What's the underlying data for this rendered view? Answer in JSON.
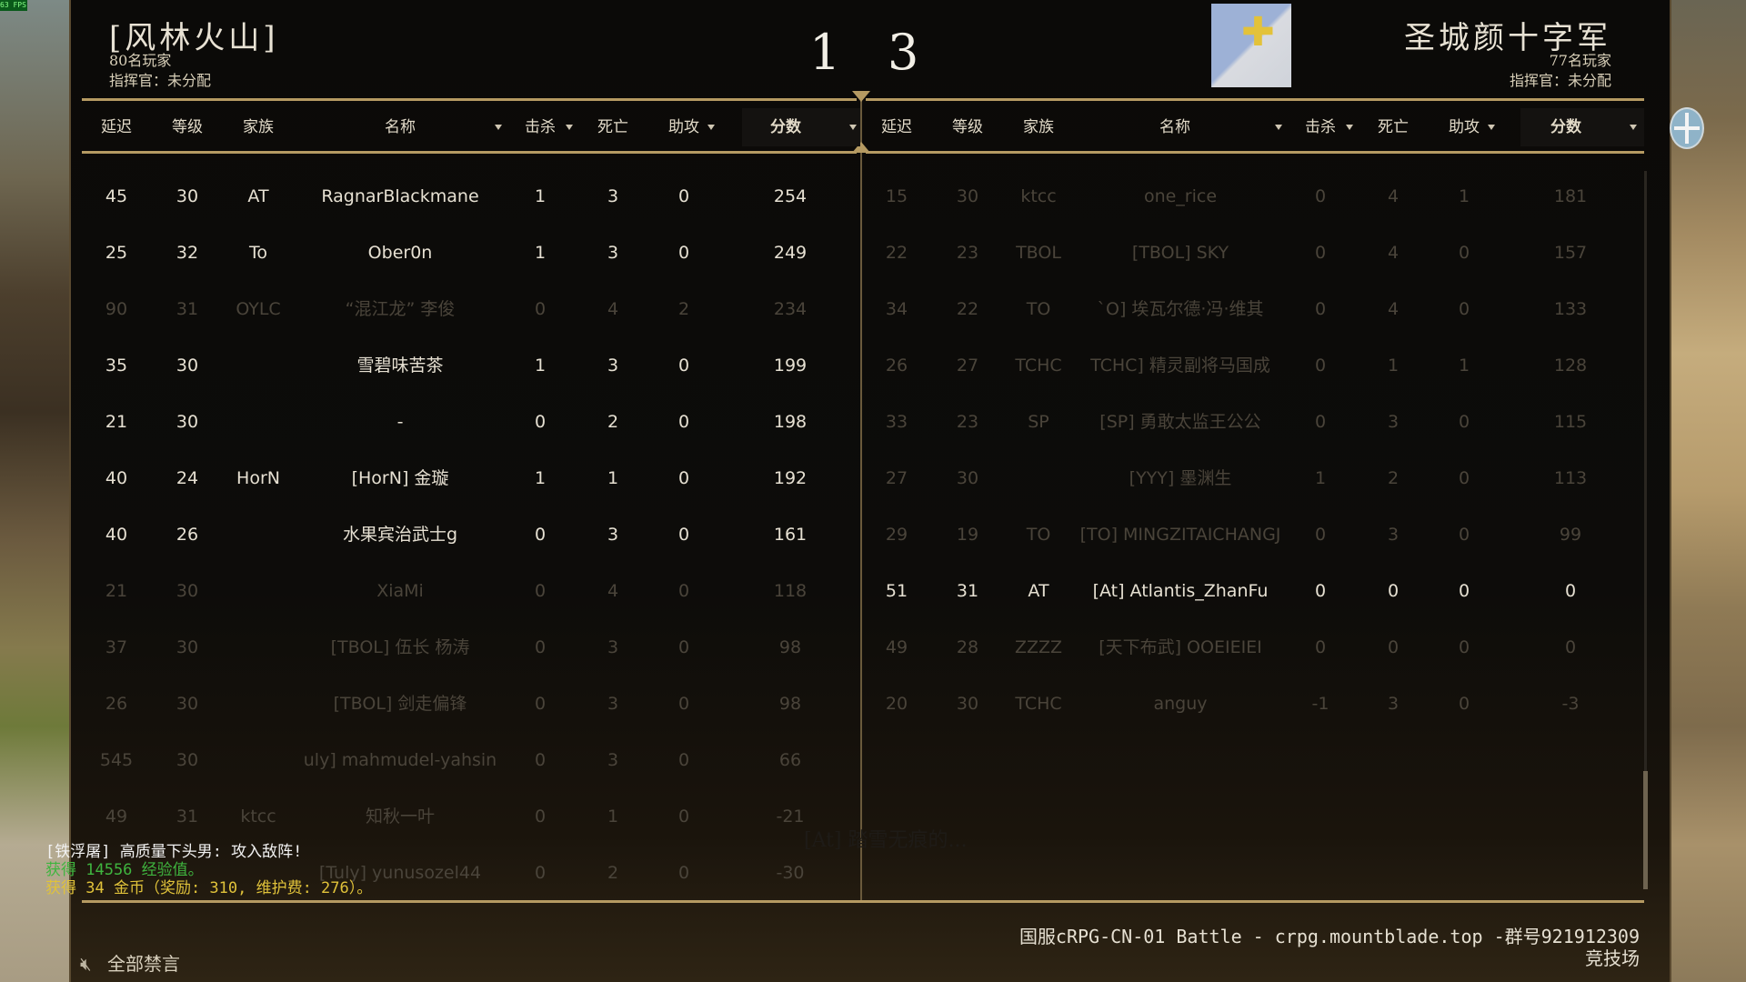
{
  "fps_label": "63 FPS",
  "left_team": {
    "name": "[风林火山]",
    "players": "80名玩家",
    "commander": "指挥官：未分配",
    "score": "1"
  },
  "right_team": {
    "name": "圣城颜十字军",
    "players": "77名玩家",
    "commander": "指挥官：未分配",
    "score": "3",
    "banner_icon": "cross-banner-icon"
  },
  "columns": {
    "ping": "延迟",
    "level": "等级",
    "clan": "家族",
    "name": "名称",
    "kills": "击杀",
    "deaths": "死亡",
    "assists": "助攻",
    "score": "分数"
  },
  "left_rows": [
    {
      "ping": "45",
      "level": "30",
      "clan": "AT",
      "name": "RagnarBlackmane",
      "kills": "1",
      "deaths": "3",
      "assists": "0",
      "score": "254",
      "alive": true
    },
    {
      "ping": "25",
      "level": "32",
      "clan": "To",
      "name": "Ober0n",
      "kills": "1",
      "deaths": "3",
      "assists": "0",
      "score": "249",
      "alive": true
    },
    {
      "ping": "90",
      "level": "31",
      "clan": "OYLC",
      "name": "“混江龙” 李俊",
      "kills": "0",
      "deaths": "4",
      "assists": "2",
      "score": "234",
      "alive": false
    },
    {
      "ping": "35",
      "level": "30",
      "clan": "",
      "name": "雪碧味苦茶",
      "kills": "1",
      "deaths": "3",
      "assists": "0",
      "score": "199",
      "alive": true
    },
    {
      "ping": "21",
      "level": "30",
      "clan": "",
      "name": "-",
      "kills": "0",
      "deaths": "2",
      "assists": "0",
      "score": "198",
      "alive": true
    },
    {
      "ping": "40",
      "level": "24",
      "clan": "HorN",
      "name": "[HorN] 金璇",
      "kills": "1",
      "deaths": "1",
      "assists": "0",
      "score": "192",
      "alive": true
    },
    {
      "ping": "40",
      "level": "26",
      "clan": "",
      "name": "水果宾治武士g",
      "kills": "0",
      "deaths": "3",
      "assists": "0",
      "score": "161",
      "alive": true
    },
    {
      "ping": "21",
      "level": "30",
      "clan": "",
      "name": "XiaMi",
      "kills": "0",
      "deaths": "4",
      "assists": "0",
      "score": "118",
      "alive": false
    },
    {
      "ping": "37",
      "level": "30",
      "clan": "",
      "name": "[TBOL] 伍长 杨涛",
      "kills": "0",
      "deaths": "3",
      "assists": "0",
      "score": "98",
      "alive": false
    },
    {
      "ping": "26",
      "level": "30",
      "clan": "",
      "name": "[TBOL] 剑走偏锋",
      "kills": "0",
      "deaths": "3",
      "assists": "0",
      "score": "98",
      "alive": false
    },
    {
      "ping": "545",
      "level": "30",
      "clan": "",
      "name": "uly] mahmudel-yahsin",
      "kills": "0",
      "deaths": "3",
      "assists": "0",
      "score": "66",
      "alive": false
    },
    {
      "ping": "49",
      "level": "31",
      "clan": "ktcc",
      "name": "知秋一叶",
      "kills": "0",
      "deaths": "1",
      "assists": "0",
      "score": "-21",
      "alive": false
    },
    {
      "ping": "",
      "level": "",
      "clan": "",
      "name": "[Tuly] yunusozel44",
      "kills": "0",
      "deaths": "2",
      "assists": "0",
      "score": "-30",
      "alive": false
    }
  ],
  "right_rows": [
    {
      "ping": "15",
      "level": "30",
      "clan": "ktcc",
      "name": "one_rice",
      "kills": "0",
      "deaths": "4",
      "assists": "1",
      "score": "181",
      "alive": false
    },
    {
      "ping": "22",
      "level": "23",
      "clan": "TBOL",
      "name": "[TBOL] SKY",
      "kills": "0",
      "deaths": "4",
      "assists": "0",
      "score": "157",
      "alive": false
    },
    {
      "ping": "34",
      "level": "22",
      "clan": "TO",
      "name": "`O] 埃瓦尔德·冯·维其",
      "kills": "0",
      "deaths": "4",
      "assists": "0",
      "score": "133",
      "alive": false
    },
    {
      "ping": "26",
      "level": "27",
      "clan": "TCHC",
      "name": "TCHC] 精灵副将马国成",
      "kills": "0",
      "deaths": "1",
      "assists": "1",
      "score": "128",
      "alive": false
    },
    {
      "ping": "33",
      "level": "23",
      "clan": "SP",
      "name": "[SP] 勇敢太监王公公",
      "kills": "0",
      "deaths": "3",
      "assists": "0",
      "score": "115",
      "alive": false
    },
    {
      "ping": "27",
      "level": "30",
      "clan": "",
      "name": "[YYY] 墨渊生",
      "kills": "1",
      "deaths": "2",
      "assists": "0",
      "score": "113",
      "alive": false
    },
    {
      "ping": "29",
      "level": "19",
      "clan": "TO",
      "name": "[TO] MINGZITAICHANGJ",
      "kills": "0",
      "deaths": "3",
      "assists": "0",
      "score": "99",
      "alive": false
    },
    {
      "ping": "51",
      "level": "31",
      "clan": "AT",
      "name": "[At] Atlantis_ZhanFu",
      "kills": "0",
      "deaths": "0",
      "assists": "0",
      "score": "0",
      "alive": true
    },
    {
      "ping": "49",
      "level": "28",
      "clan": "ZZZZ",
      "name": "[天下布武] OOEIEIEI",
      "kills": "0",
      "deaths": "0",
      "assists": "0",
      "score": "0",
      "alive": false
    },
    {
      "ping": "20",
      "level": "30",
      "clan": "TCHC",
      "name": "anguy",
      "kills": "-1",
      "deaths": "3",
      "assists": "0",
      "score": "-3",
      "alive": false
    }
  ],
  "chat": [
    {
      "text": "[铁浮屠] 高质量下头男: 攻入敌阵!",
      "color": "#f2f2f2"
    },
    {
      "text": "获得 14556 经验值。",
      "color": "#3fb53f"
    },
    {
      "text": "获得 34 金币（奖励: 310, 维护费: 276）。",
      "color": "#e0c23a"
    }
  ],
  "server": {
    "line1": "国服cRPG-CN-01 Battle - crpg.mountblade.top -群号921912309",
    "line2": "竞技场"
  },
  "mute_all": "全部禁言",
  "ghost_text": "[At] 踏雪无痕的..."
}
